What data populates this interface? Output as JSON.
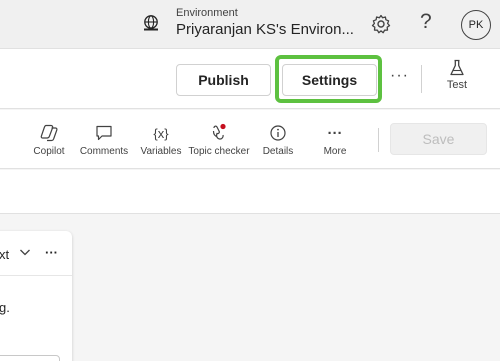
{
  "header": {
    "environment_label": "Environment",
    "environment_name": "Priyaranjan KS's Environ...",
    "help_glyph": "?",
    "avatar_initials": "PK",
    "icons": [
      "environment-icon",
      "gear-icon",
      "help-icon"
    ]
  },
  "commandbar": {
    "publish_label": "Publish",
    "settings_label": "Settings",
    "more_glyph": "···",
    "test_label": "Test",
    "highlight_color": "#5dc140"
  },
  "toolbar": {
    "items": [
      {
        "label": "Copilot",
        "icon": "copilot-icon"
      },
      {
        "label": "Comments",
        "icon": "comment-icon"
      },
      {
        "label": "Variables",
        "icon": "variables-icon"
      },
      {
        "label": "Topic checker",
        "icon": "topic-checker-icon"
      },
      {
        "label": "Details",
        "icon": "info-icon"
      },
      {
        "label": "More",
        "icon": "more-icon"
      }
    ],
    "variables_glyph": "{x}",
    "more_glyph": "···",
    "save_label": "Save"
  },
  "canvas": {
    "card_title_fragment": "xt",
    "card_more_glyph": "···",
    "card_body_fragment": "g."
  }
}
